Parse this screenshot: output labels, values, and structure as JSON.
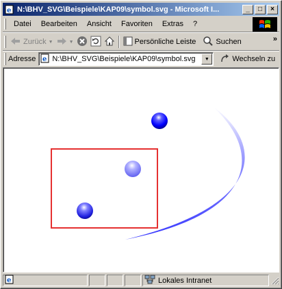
{
  "window": {
    "title": "N:\\BHV_SVG\\Beispiele\\KAP09\\symbol.svg - Microsoft I...",
    "buttons": {
      "minimize": "_",
      "maximize": "□",
      "close": "×"
    }
  },
  "menu": {
    "items": [
      "Datei",
      "Bearbeiten",
      "Ansicht",
      "Favoriten",
      "Extras",
      "?"
    ]
  },
  "toolbar": {
    "back_label": "Zurück",
    "personal_bar_label": "Persönliche Leiste",
    "search_label": "Suchen",
    "more": "»"
  },
  "address": {
    "label": "Adresse",
    "value": "N:\\BHV_SVG\\Beispiele\\KAP09\\symbol.svg",
    "go_label": "Wechseln zu"
  },
  "status": {
    "zone_label": "Lokales Intranet"
  },
  "colors": {
    "title_start": "#0a246a",
    "title_end": "#a6caf0",
    "rect_stroke": "#e53030",
    "sphere_blue": "#0000ff",
    "arc_blue": "#4a4aff"
  },
  "icons": {
    "title": "ie-page-icon",
    "back": "back-arrow-icon",
    "forward": "forward-arrow-icon",
    "stop": "stop-icon",
    "refresh": "refresh-icon",
    "home": "home-icon",
    "personal_bar": "personal-bar-icon",
    "search": "search-icon",
    "address": "ie-page-icon",
    "go": "go-arrow-icon",
    "status": "page-icon",
    "zone": "intranet-icon"
  }
}
